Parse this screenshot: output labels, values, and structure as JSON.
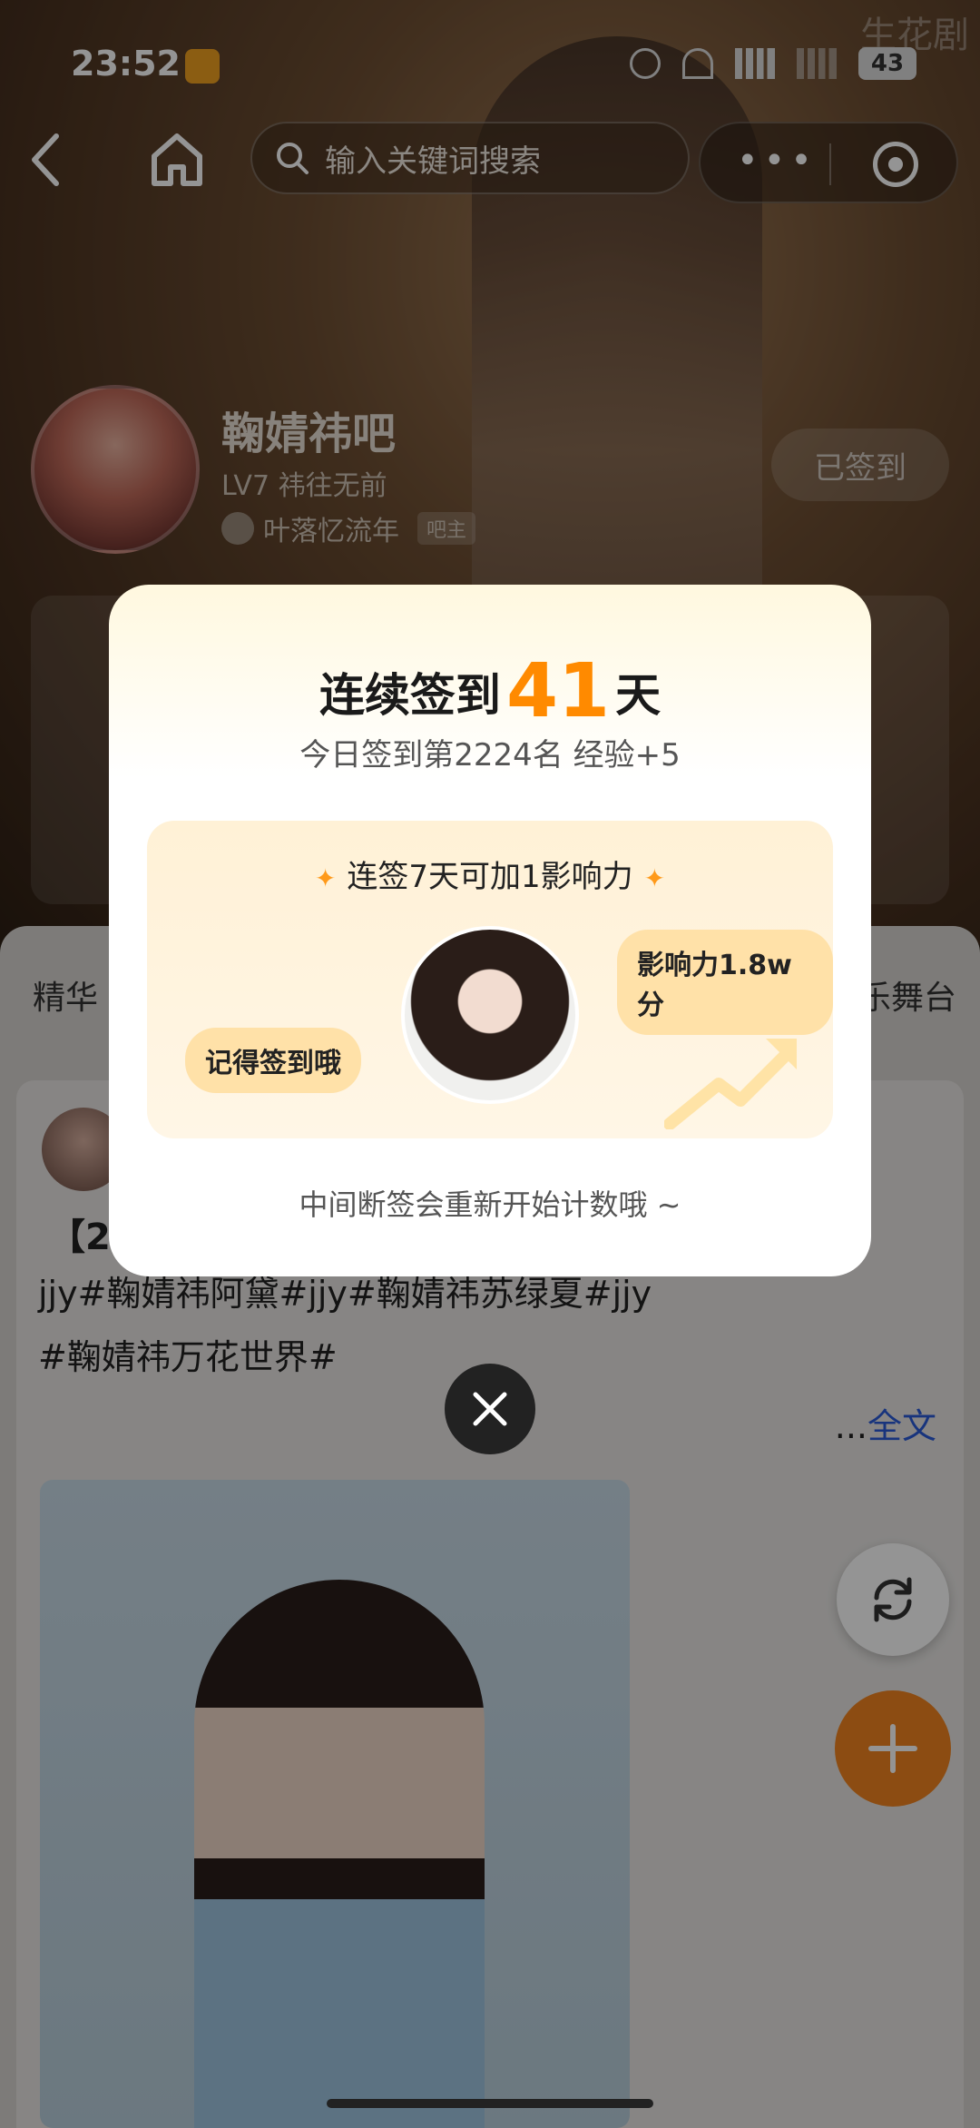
{
  "status_bar": {
    "time": "23:52",
    "battery": "43",
    "watermark": "生花剧"
  },
  "nav": {
    "search_placeholder": "输入关键词搜索",
    "more": "•••"
  },
  "forum": {
    "name": "鞠婧祎吧",
    "level": "LV7 祎往无前",
    "owner_name": "叶落忆流年",
    "owner_badge": "吧主",
    "signed_label": "已签到"
  },
  "tabs": {
    "left": "精华",
    "right": "乐舞台"
  },
  "post": {
    "title": "【20",
    "text_line1": "jjy#鞠婧祎阿黛#jjy#鞠婧祎苏绿夏#jjy",
    "text_line2": "#鞠婧祎万花世界#",
    "more_prefix": "...",
    "more_label": "全文"
  },
  "modal": {
    "title_prefix": "连续签到",
    "streak_days": "41",
    "title_suffix": "天",
    "subtitle": "今日签到第2224名 经验+5",
    "reward_title": "连签7天可加1影响力",
    "star": "✦",
    "bubble_left": "记得签到哦",
    "bubble_right": "影响力1.8w分",
    "footer": "中间断签会重新开始计数哦 ~"
  },
  "colors": {
    "accent": "#ff8a00",
    "fab": "#f2841f",
    "link": "#2a5bd8"
  }
}
